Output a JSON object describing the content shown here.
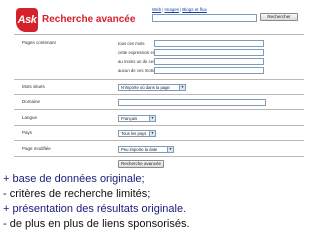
{
  "header": {
    "logo_text": "Ask",
    "page_title": "Recherche avancée",
    "links": [
      "Web",
      "Images",
      "Blogs et flux"
    ],
    "search_button": "Rechercher"
  },
  "form": {
    "pages_contenant": {
      "label": "Pages contenant",
      "fields": [
        "tous ces mots",
        "cette expression exacte",
        "au moins un de ces mots",
        "aucun de ces mots"
      ]
    },
    "mots_situes": {
      "label": "Mots situés",
      "value": "N'importe où dans la page"
    },
    "domaine": {
      "label": "Domaine"
    },
    "langue": {
      "label": "Langue",
      "value": "Français"
    },
    "pays": {
      "label": "Pays",
      "value": "Tous les pays"
    },
    "page_modifiee": {
      "label": "Page modifiée",
      "value": "Peu importe la date"
    },
    "submit_button": "Recherche avancée"
  },
  "bullets": [
    "+ base de données originale;",
    "- critères de recherche limités;",
    "+ présentation des résultats originale.",
    "- de plus en plus de liens sponsorisés."
  ]
}
